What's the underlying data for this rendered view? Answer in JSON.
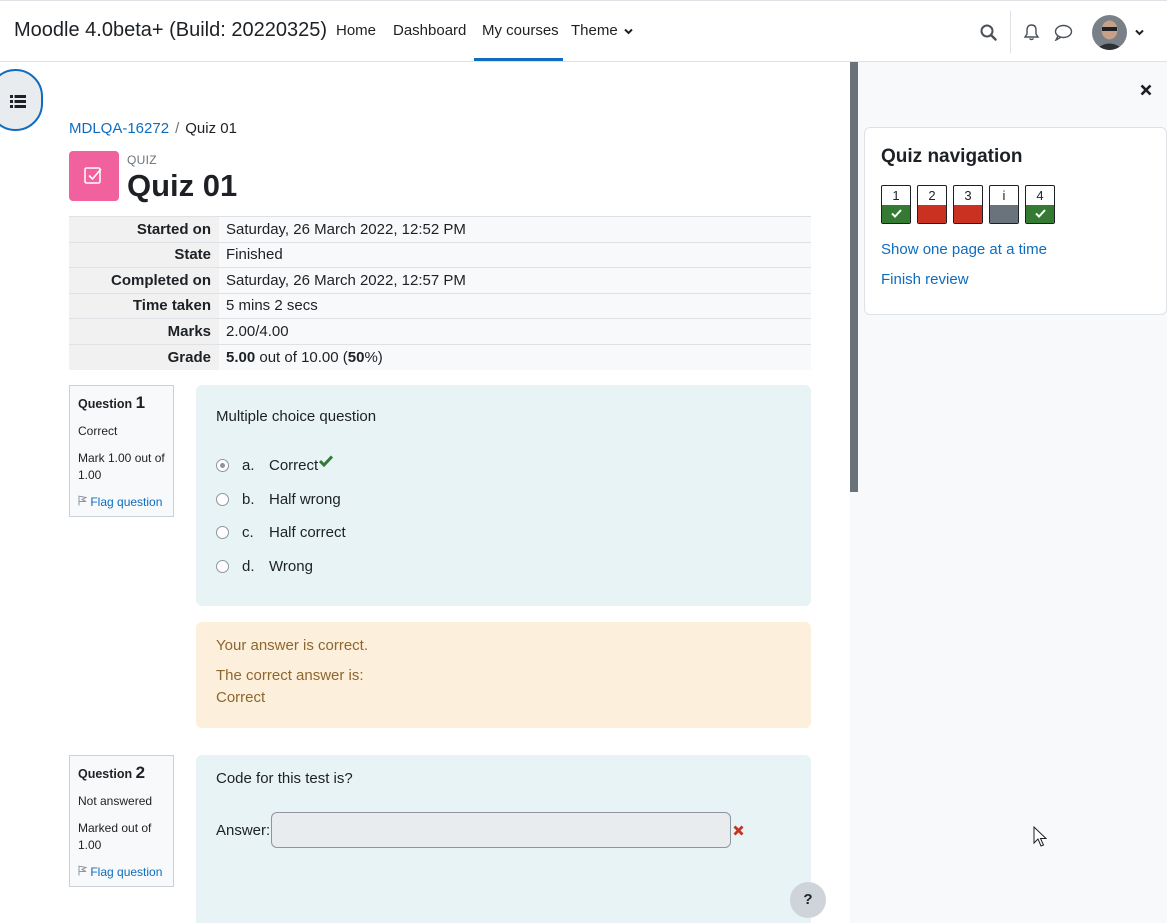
{
  "navbar": {
    "site_name": "Moodle 4.0beta+ (Build: 20220325)",
    "items": [
      {
        "label": "Home"
      },
      {
        "label": "Dashboard"
      },
      {
        "label": "My courses"
      },
      {
        "label": "Theme"
      }
    ],
    "active_item": "My courses"
  },
  "breadcrumb": {
    "course": "MDLQA-16272",
    "separator": "/",
    "current": "Quiz 01"
  },
  "header": {
    "activity_type": "QUIZ",
    "title": "Quiz 01",
    "icon_color": "#f0619e"
  },
  "summary": {
    "rows": [
      {
        "label": "Started on",
        "value": "Saturday, 26 March 2022, 12:52 PM"
      },
      {
        "label": "State",
        "value": "Finished"
      },
      {
        "label": "Completed on",
        "value": "Saturday, 26 March 2022, 12:57 PM"
      },
      {
        "label": "Time taken",
        "value": "5 mins 2 secs"
      },
      {
        "label": "Marks",
        "value": "2.00/4.00"
      }
    ],
    "grade": {
      "label": "Grade",
      "score": "5.00",
      "middle": " out of 10.00 (",
      "percent": "50",
      "end": "%)"
    }
  },
  "questions": [
    {
      "prefix": "Question",
      "number": "1",
      "state": "Correct",
      "mark": "Mark 1.00 out of 1.00",
      "flag": "Flag question",
      "text": "Multiple choice question",
      "options": [
        {
          "letter": "a.",
          "text": "Correct",
          "selected": true
        },
        {
          "letter": "b.",
          "text": "Half wrong"
        },
        {
          "letter": "c.",
          "text": "Half correct"
        },
        {
          "letter": "d.",
          "text": "Wrong"
        }
      ],
      "feedback": {
        "result": "Your answer is correct.",
        "right_label": "The correct answer is:",
        "right_answer": "Correct"
      }
    },
    {
      "prefix": "Question",
      "number": "2",
      "state": "Not answered",
      "mark": "Marked out of 1.00",
      "flag": "Flag question",
      "text": "Code for this test is?",
      "answer_label": "Answer:",
      "answer_value": ""
    }
  ],
  "quiz_navigation": {
    "title": "Quiz navigation",
    "buttons": [
      {
        "label": "1",
        "state": "correct"
      },
      {
        "label": "2",
        "state": "wrong"
      },
      {
        "label": "3",
        "state": "wrong"
      },
      {
        "label": "i",
        "state": "info"
      },
      {
        "label": "4",
        "state": "correct"
      }
    ],
    "links": [
      "Show one page at a time",
      "Finish review"
    ]
  },
  "colors": {
    "primary": "#0f6cbf",
    "correct": "#357a32",
    "wrong": "#ca3120",
    "info_panel": "#e7f3f5",
    "feedback_panel": "#fcefdc"
  },
  "icons": [
    "search-icon",
    "bell-icon",
    "chat-icon",
    "chevron-down-icon",
    "list-icon",
    "close-icon",
    "flag-icon",
    "check-icon",
    "cross-icon",
    "help-icon"
  ],
  "help_button": "?"
}
